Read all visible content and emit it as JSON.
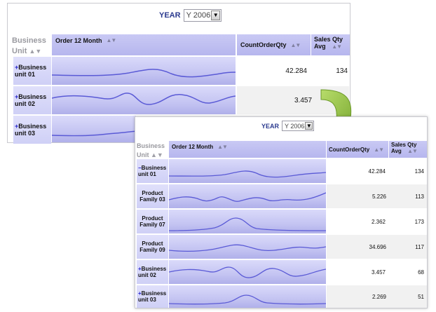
{
  "year": {
    "label": "YEAR",
    "value": "Y 2006"
  },
  "headers": {
    "bu_line1": "Business",
    "bu_line2": "Unit",
    "order": "Order 12 Month",
    "count": "CountOrderQty",
    "sales_line1": "Sales Qty",
    "sales_line2": "Avg"
  },
  "panel1": {
    "rows": [
      {
        "sym": "+",
        "line1": "Business",
        "line2": "unit 01",
        "count": "42.284",
        "sales": "134"
      },
      {
        "sym": "+",
        "line1": "Business",
        "line2": "unit 02",
        "count": "3.457",
        "sales": ""
      },
      {
        "sym": "+",
        "line1": "Business",
        "line2": "unit 03",
        "count": "",
        "sales": ""
      }
    ]
  },
  "panel2": {
    "rows": [
      {
        "sym": "−",
        "line1": "Business",
        "line2": "unit 01",
        "count": "42.284",
        "sales": "134"
      },
      {
        "sym": "",
        "line1": "Product",
        "line2": "Family 03",
        "count": "5.226",
        "sales": "113"
      },
      {
        "sym": "",
        "line1": "Product",
        "line2": "Family 07",
        "count": "2.362",
        "sales": "173"
      },
      {
        "sym": "",
        "line1": "Product",
        "line2": "Family 09",
        "count": "34.696",
        "sales": "117"
      },
      {
        "sym": "+",
        "line1": "Business",
        "line2": "unit 02",
        "count": "3.457",
        "sales": "68"
      },
      {
        "sym": "+",
        "line1": "Business",
        "line2": "unit 03",
        "count": "2.269",
        "sales": "51"
      }
    ]
  },
  "colors": {
    "accent": "#2b3a8f",
    "header_bg": "#c0c0f2",
    "spark_line": "#5a5ad6",
    "arrow": "#8fbf3a"
  }
}
